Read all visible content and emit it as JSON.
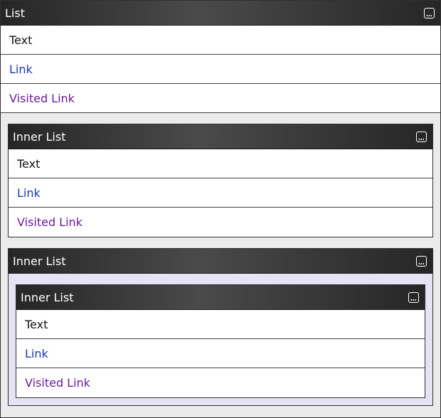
{
  "outer": {
    "title": "List",
    "rows": {
      "text": "Text",
      "link": "Link",
      "visited": "Visited Link"
    }
  },
  "inner1": {
    "title": "Inner List",
    "rows": {
      "text": "Text",
      "link": "Link",
      "visited": "Visited Link"
    }
  },
  "inner2": {
    "title": "Inner List",
    "nested": {
      "title": "Inner List",
      "rows": {
        "text": "Text",
        "link": "Link",
        "visited": "Visited Link"
      }
    }
  },
  "icons": {
    "menu": "ellipsis-square-icon"
  },
  "colors": {
    "header_dark": "#262626",
    "header_light": "#4a4a4a",
    "link": "#1a37b5",
    "visited_link": "#6a1a9a",
    "outer_bg": "#ebebeb",
    "nest_bg": "#e4e4f4"
  }
}
